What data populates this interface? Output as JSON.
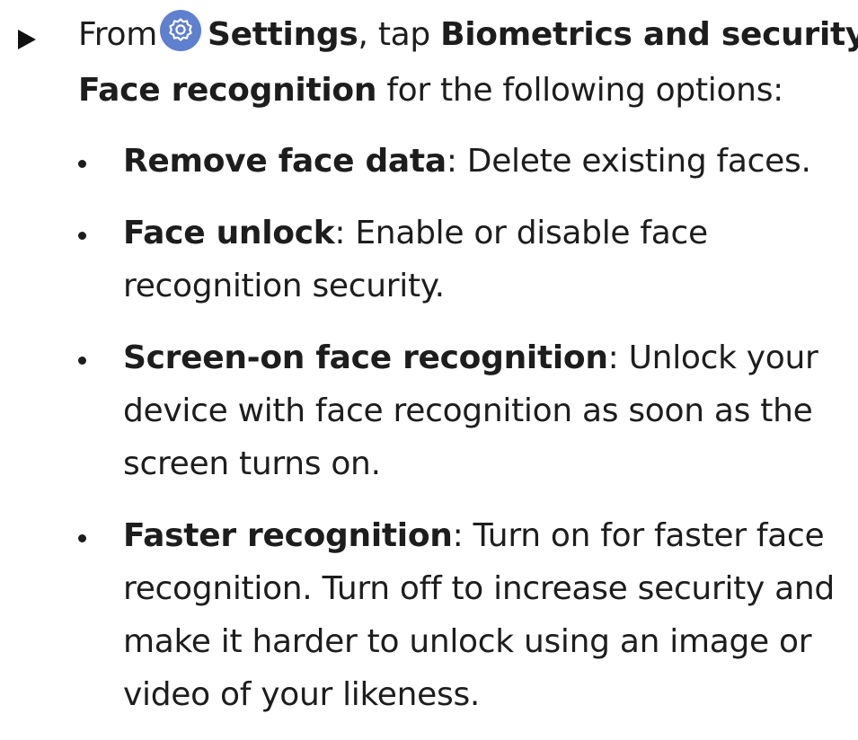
{
  "step": {
    "from_text": "From",
    "settings_label": "Settings",
    "tap_text": ", tap",
    "biometrics_label": "Biometrics and security",
    "chevron": "›",
    "face_recognition_label": "Face recognition",
    "tail_text": "for the following options:",
    "icon_color": "#5f7fcf"
  },
  "options": [
    {
      "title": "Remove face data",
      "description": ": Delete existing faces."
    },
    {
      "title": "Face unlock",
      "description": ": Enable or disable face recognition security."
    },
    {
      "title": "Screen-on face recognition",
      "description": ": Unlock your device with face recognition as soon as the screen turns on."
    },
    {
      "title": "Faster recognition",
      "description": ": Turn on for faster face recognition. Turn off to increase security and make it harder to unlock using an image or video of your likeness."
    }
  ]
}
